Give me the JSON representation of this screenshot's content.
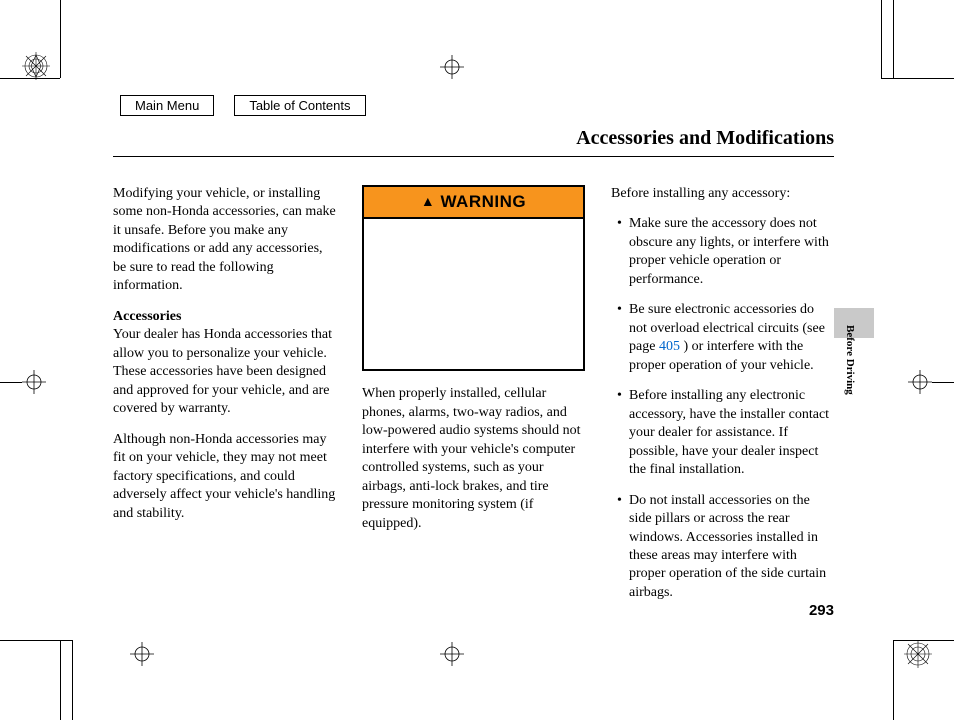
{
  "nav": {
    "main_menu": "Main Menu",
    "toc": "Table of Contents"
  },
  "title": "Accessories and Modifications",
  "side_tab": "Before Driving",
  "page_number": "293",
  "col1": {
    "p1": "Modifying your vehicle, or installing some non-Honda accessories, can make it unsafe. Before you make any modifications or add any accessories, be sure to read the following information.",
    "subhead": "Accessories",
    "p2": "Your dealer has Honda accessories that allow you to personalize your vehicle. These accessories have been designed and approved for your vehicle, and are covered by warranty.",
    "p3": "Although non-Honda accessories may fit on your vehicle, they may not meet factory specifications, and could adversely affect your vehicle's handling and stability."
  },
  "col2": {
    "warning_label": "WARNING",
    "p1": "When properly installed, cellular phones, alarms, two-way radios, and low-powered audio systems should not interfere with your vehicle's computer controlled systems, such as your airbags, anti-lock brakes, and tire pressure monitoring system (if equipped)."
  },
  "col3": {
    "intro": "Before installing any accessory:",
    "b1": "Make sure the accessory does not obscure any lights, or interfere with proper vehicle operation or performance.",
    "b2a": "Be sure electronic accessories do not overload electrical circuits (see page ",
    "b2_ref": "405",
    "b2b": " ) or interfere with the proper operation of your vehicle.",
    "b3": "Before installing any electronic accessory, have the installer contact your dealer for assistance. If possible, have your dealer inspect the final installation.",
    "b4": "Do not install accessories on the side pillars or across the rear windows. Accessories installed in these areas may interfere with proper operation of the side curtain airbags."
  }
}
